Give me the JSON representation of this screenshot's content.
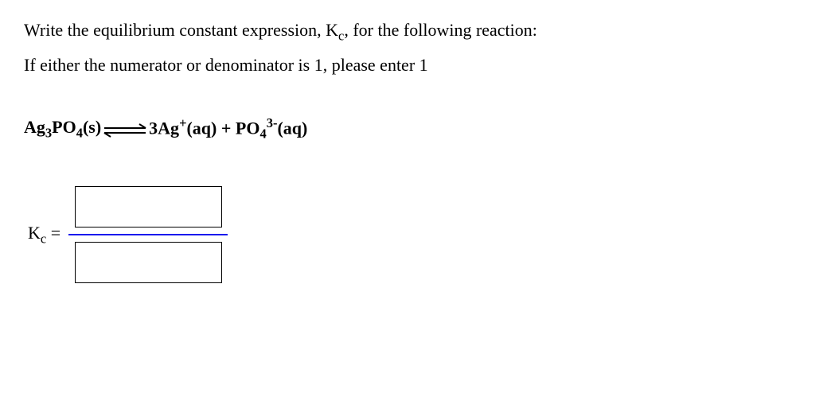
{
  "question": {
    "line1_part1": "Write the equilibrium constant expression, K",
    "line1_sub": "c",
    "line1_part2": ", for the following reaction:",
    "line2": "If either the numerator or denominator is 1, please enter 1"
  },
  "equation": {
    "reactant": {
      "formula_prefix": "Ag",
      "sub1": "3",
      "formula_mid": "PO",
      "sub2": "4",
      "state": "(s)"
    },
    "products": {
      "p1_coeff": "3Ag",
      "p1_sup": "+",
      "p1_state": "(aq)",
      "plus": " + ",
      "p2_prefix": "PO",
      "p2_sub": "4",
      "p2_sup": "3-",
      "p2_state": "(aq)"
    }
  },
  "expression": {
    "label_prefix": "K",
    "label_sub": "c",
    "equals": " = ",
    "numerator_value": "",
    "denominator_value": ""
  }
}
